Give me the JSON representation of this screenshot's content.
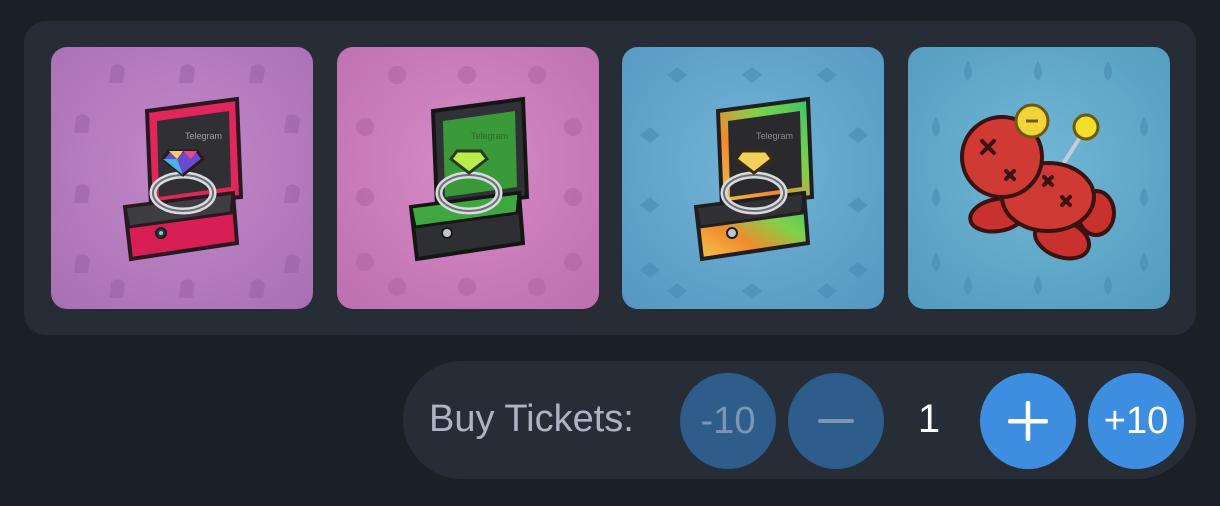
{
  "gifts": [
    {
      "name": "red-ring-box",
      "icon": "ring-box-icon",
      "bg": "#b179bd",
      "box": "#e0265a",
      "gem": "multicolor",
      "brand": "Telegram"
    },
    {
      "name": "green-ring-box",
      "icon": "ring-box-icon",
      "bg": "#c779b8",
      "box": "#2f3136",
      "gem": "#b6ee4a",
      "brand": "Telegram"
    },
    {
      "name": "rainbow-ring-box",
      "icon": "ring-box-icon",
      "bg": "#5fa1c8",
      "box": "gradient",
      "gem": "#f2d15a",
      "brand": "Telegram"
    },
    {
      "name": "voodoo-doll",
      "icon": "voodoo-doll-icon",
      "bg": "#5da6c6"
    }
  ],
  "tickets": {
    "label": "Buy Tickets:",
    "minus10_label": "-10",
    "minus_icon": "minus-icon",
    "quantity": "1",
    "plus_icon": "plus-icon",
    "plus10_label": "+10"
  },
  "colors": {
    "page_bg": "#1b2026",
    "panel_bg": "#262d36",
    "button_disabled": "#2e5c8b",
    "button_active": "#3d8ee0"
  }
}
